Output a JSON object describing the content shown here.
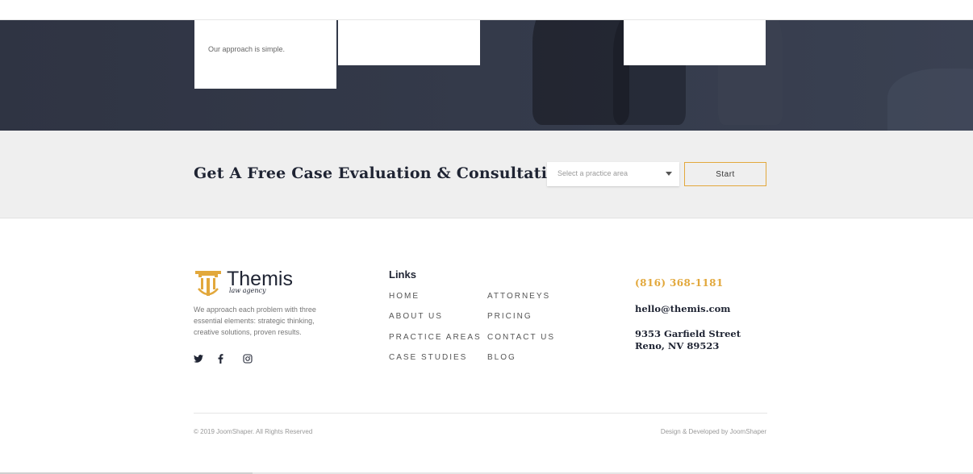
{
  "hero": {
    "card_text_line": "Our approach is simple."
  },
  "cta": {
    "title": "Get A Free Case Evaluation & Consultation",
    "select_placeholder": "Select a practice area",
    "start_label": "Start"
  },
  "footer": {
    "logo": {
      "name": "Themis",
      "tagline": "law agency",
      "color": "#e2a83c"
    },
    "about": "We approach each problem with three essential elements: strategic thinking, creative solutions, proven results.",
    "social": [
      "twitter-icon",
      "facebook-icon",
      "instagram-icon"
    ],
    "links_title": "Links",
    "links_col1": [
      "HOME",
      "ABOUT US",
      "PRACTICE AREAS",
      "CASE STUDIES"
    ],
    "links_col2": [
      "ATTORNEYS",
      "PRICING",
      "CONTACT US",
      "BLOG"
    ],
    "contact": {
      "phone": "(816) 368-1181",
      "email": "hello@themis.com",
      "address_line1": "9353 Garfield Street",
      "address_line2": "Reno, NV 89523"
    },
    "copyright": "© 2019 JoomShaper. All Rights Reserved",
    "credit": "Design & Developed by JoomShaper"
  },
  "colors": {
    "accent": "#e2a83c",
    "dark": "#1f2433",
    "hero_bg": "#343a4a"
  }
}
